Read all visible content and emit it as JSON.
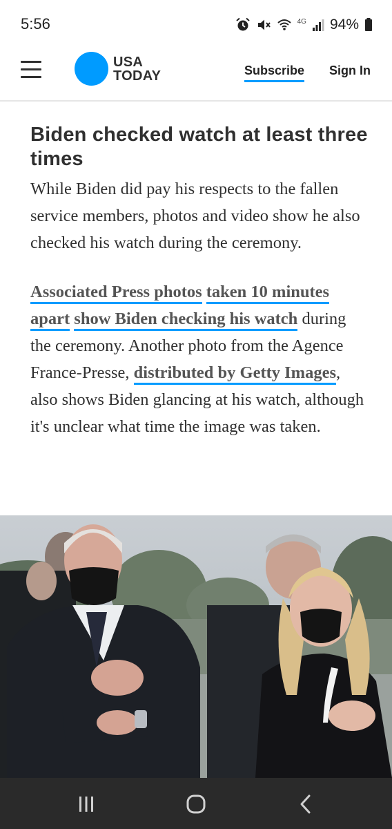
{
  "status_bar": {
    "time": "5:56",
    "network": "4G",
    "battery": "94%"
  },
  "header": {
    "logo_line1": "USA",
    "logo_line2": "TODAY",
    "subscribe": "Subscribe",
    "sign_in": "Sign In",
    "brand_color": "#009bff"
  },
  "article": {
    "headline": "Biden checked watch at least three times",
    "paragraph1": "While Biden did pay his respects to the fallen service members, photos and video show he also checked his watch during the ceremony.",
    "paragraph2": {
      "link1": "Associated Press photos",
      "link2": "taken 10 minutes apart",
      "link3": "show Biden checking his watch",
      "text1": " during the ceremony. Another photo from the Agence France-Presse, ",
      "link4": "distributed by Getty Images",
      "text2": ", also shows Biden glancing at his watch, although it's unclear what time the image was taken."
    }
  },
  "nav_bar": {
    "recents": "recents-icon",
    "home": "home-icon",
    "back": "back-icon"
  }
}
